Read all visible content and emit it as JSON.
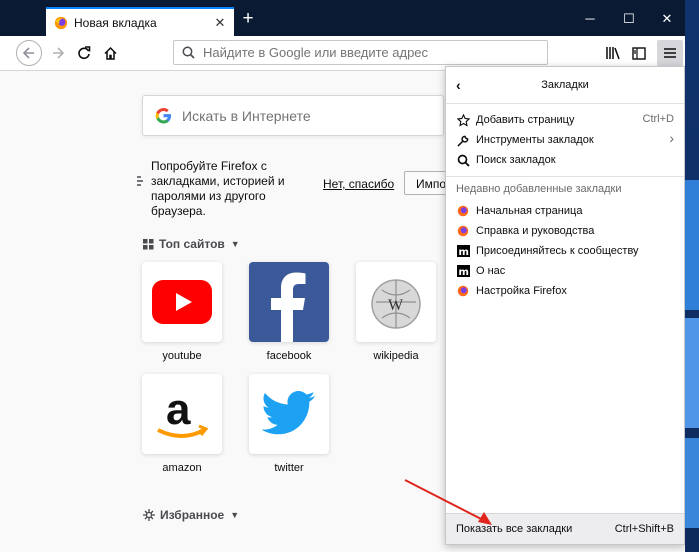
{
  "tab": {
    "title": "Новая вкладка",
    "close": "✕"
  },
  "window": {
    "new_tab": "+",
    "minimize": "─",
    "maximize": "☐",
    "close": "✕"
  },
  "url": {
    "placeholder": "Найдите в Google или введите адрес"
  },
  "search": {
    "placeholder": "Искать в Интернете"
  },
  "promo": {
    "text": "Попробуйте Firefox с закладками, историей и паролями из другого браузера.",
    "no_thanks": "Нет, спасибо",
    "import": "Импор"
  },
  "top_sites": {
    "heading": "Топ сайтов",
    "items": [
      {
        "name": "youtube"
      },
      {
        "name": "facebook"
      },
      {
        "name": "wikipedia"
      },
      {
        "name": "amazon"
      },
      {
        "name": "twitter"
      }
    ]
  },
  "favorites": {
    "heading": "Избранное"
  },
  "panel": {
    "title": "Закладки",
    "actions": [
      {
        "label": "Добавить страницу",
        "shortcut": "Ctrl+D",
        "icon": "star-icon"
      },
      {
        "label": "Инструменты закладок",
        "shortcut": "›",
        "icon": "wrench-icon"
      },
      {
        "label": "Поиск закладок",
        "shortcut": "",
        "icon": "search-icon"
      }
    ],
    "recent_heading": "Недавно добавленные закладки",
    "recent": [
      {
        "label": "Начальная страница",
        "icon": "firefox-icon"
      },
      {
        "label": "Справка и руководства",
        "icon": "firefox-icon"
      },
      {
        "label": "Присоединяйтесь к сообществу",
        "icon": "mozilla-icon"
      },
      {
        "label": "О нас",
        "icon": "mozilla-icon"
      },
      {
        "label": "Настройка Firefox",
        "icon": "firefox-icon"
      }
    ],
    "footer": {
      "label": "Показать все закладки",
      "shortcut": "Ctrl+Shift+B"
    }
  },
  "colors": {
    "accent": "#0a84ff",
    "titlebar": "#0b1a33",
    "arrow": "#e0251c"
  }
}
